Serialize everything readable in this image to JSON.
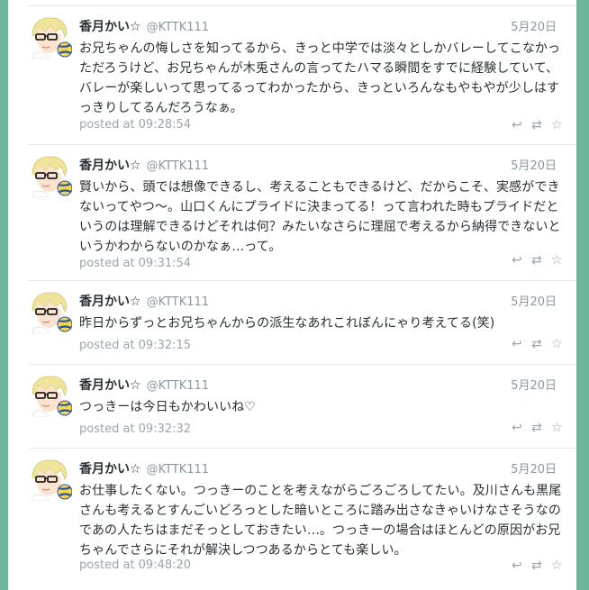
{
  "tweets": [
    {
      "name": "香月かい☆",
      "handle": "@KTTK111",
      "date": "5月20日",
      "lines": [
        "お兄ちゃんの悔しさを知ってるから、きっと中学では淡々としかバレーしてこなかっ",
        "ただろうけど、お兄ちゃんが木兎さんの言ってたハマる瞬間をすでに経験していて、",
        "バレーが楽しいって思ってるってわかったから、きっといろんなもやもやが少しはす",
        "っきりしてるんだろうなぁ。"
      ],
      "posted": "posted at 09:28:54"
    },
    {
      "name": "香月かい☆",
      "handle": "@KTTK111",
      "date": "5月20日",
      "lines": [
        "賢いから、頭では想像できるし、考えることもできるけど、だからこそ、実感ができ",
        "ないってやつ〜。山口くんにプライドに決まってる！って言われた時もプライドだと",
        "いうのは理解できるけどそれは何？みたいなさらに理屈で考えるから納得できないと",
        "いうかわからないのかなぁ…って。"
      ],
      "posted": "posted at 09:31:54"
    },
    {
      "name": "香月かい☆",
      "handle": "@KTTK111",
      "date": "5月20日",
      "lines": [
        "昨日からずっとお兄ちゃんからの派生なあれこれぼんにゃり考えてる(笑)"
      ],
      "posted": "posted at 09:32:15"
    },
    {
      "name": "香月かい☆",
      "handle": "@KTTK111",
      "date": "5月20日",
      "lines": [
        "つっきーは今日もかわいいね♡"
      ],
      "posted": "posted at 09:32:32"
    },
    {
      "name": "香月かい☆",
      "handle": "@KTTK111",
      "date": "5月20日",
      "lines": [
        "お仕事したくない。つっきーのことを考えながらごろごろしてたい。及川さんも黒尾",
        "さんも考えるとすんごいどろっとした暗いところに踏み出さなきゃいけなさそうなの",
        "であの人たちはまだそっとしておきたい…。つっきーの場合はほとんどの原因がお兄",
        "ちゃんでさらにそれが解決しつつあるからとても楽しい。"
      ],
      "posted": "posted at 09:48:20"
    }
  ],
  "icons": {
    "reply": "reply-icon",
    "retweet": "retweet-icon",
    "favorite": "star-icon"
  },
  "colors": {
    "frame": "#6fb59a",
    "name": "#292f33",
    "meta": "#8899a6"
  }
}
